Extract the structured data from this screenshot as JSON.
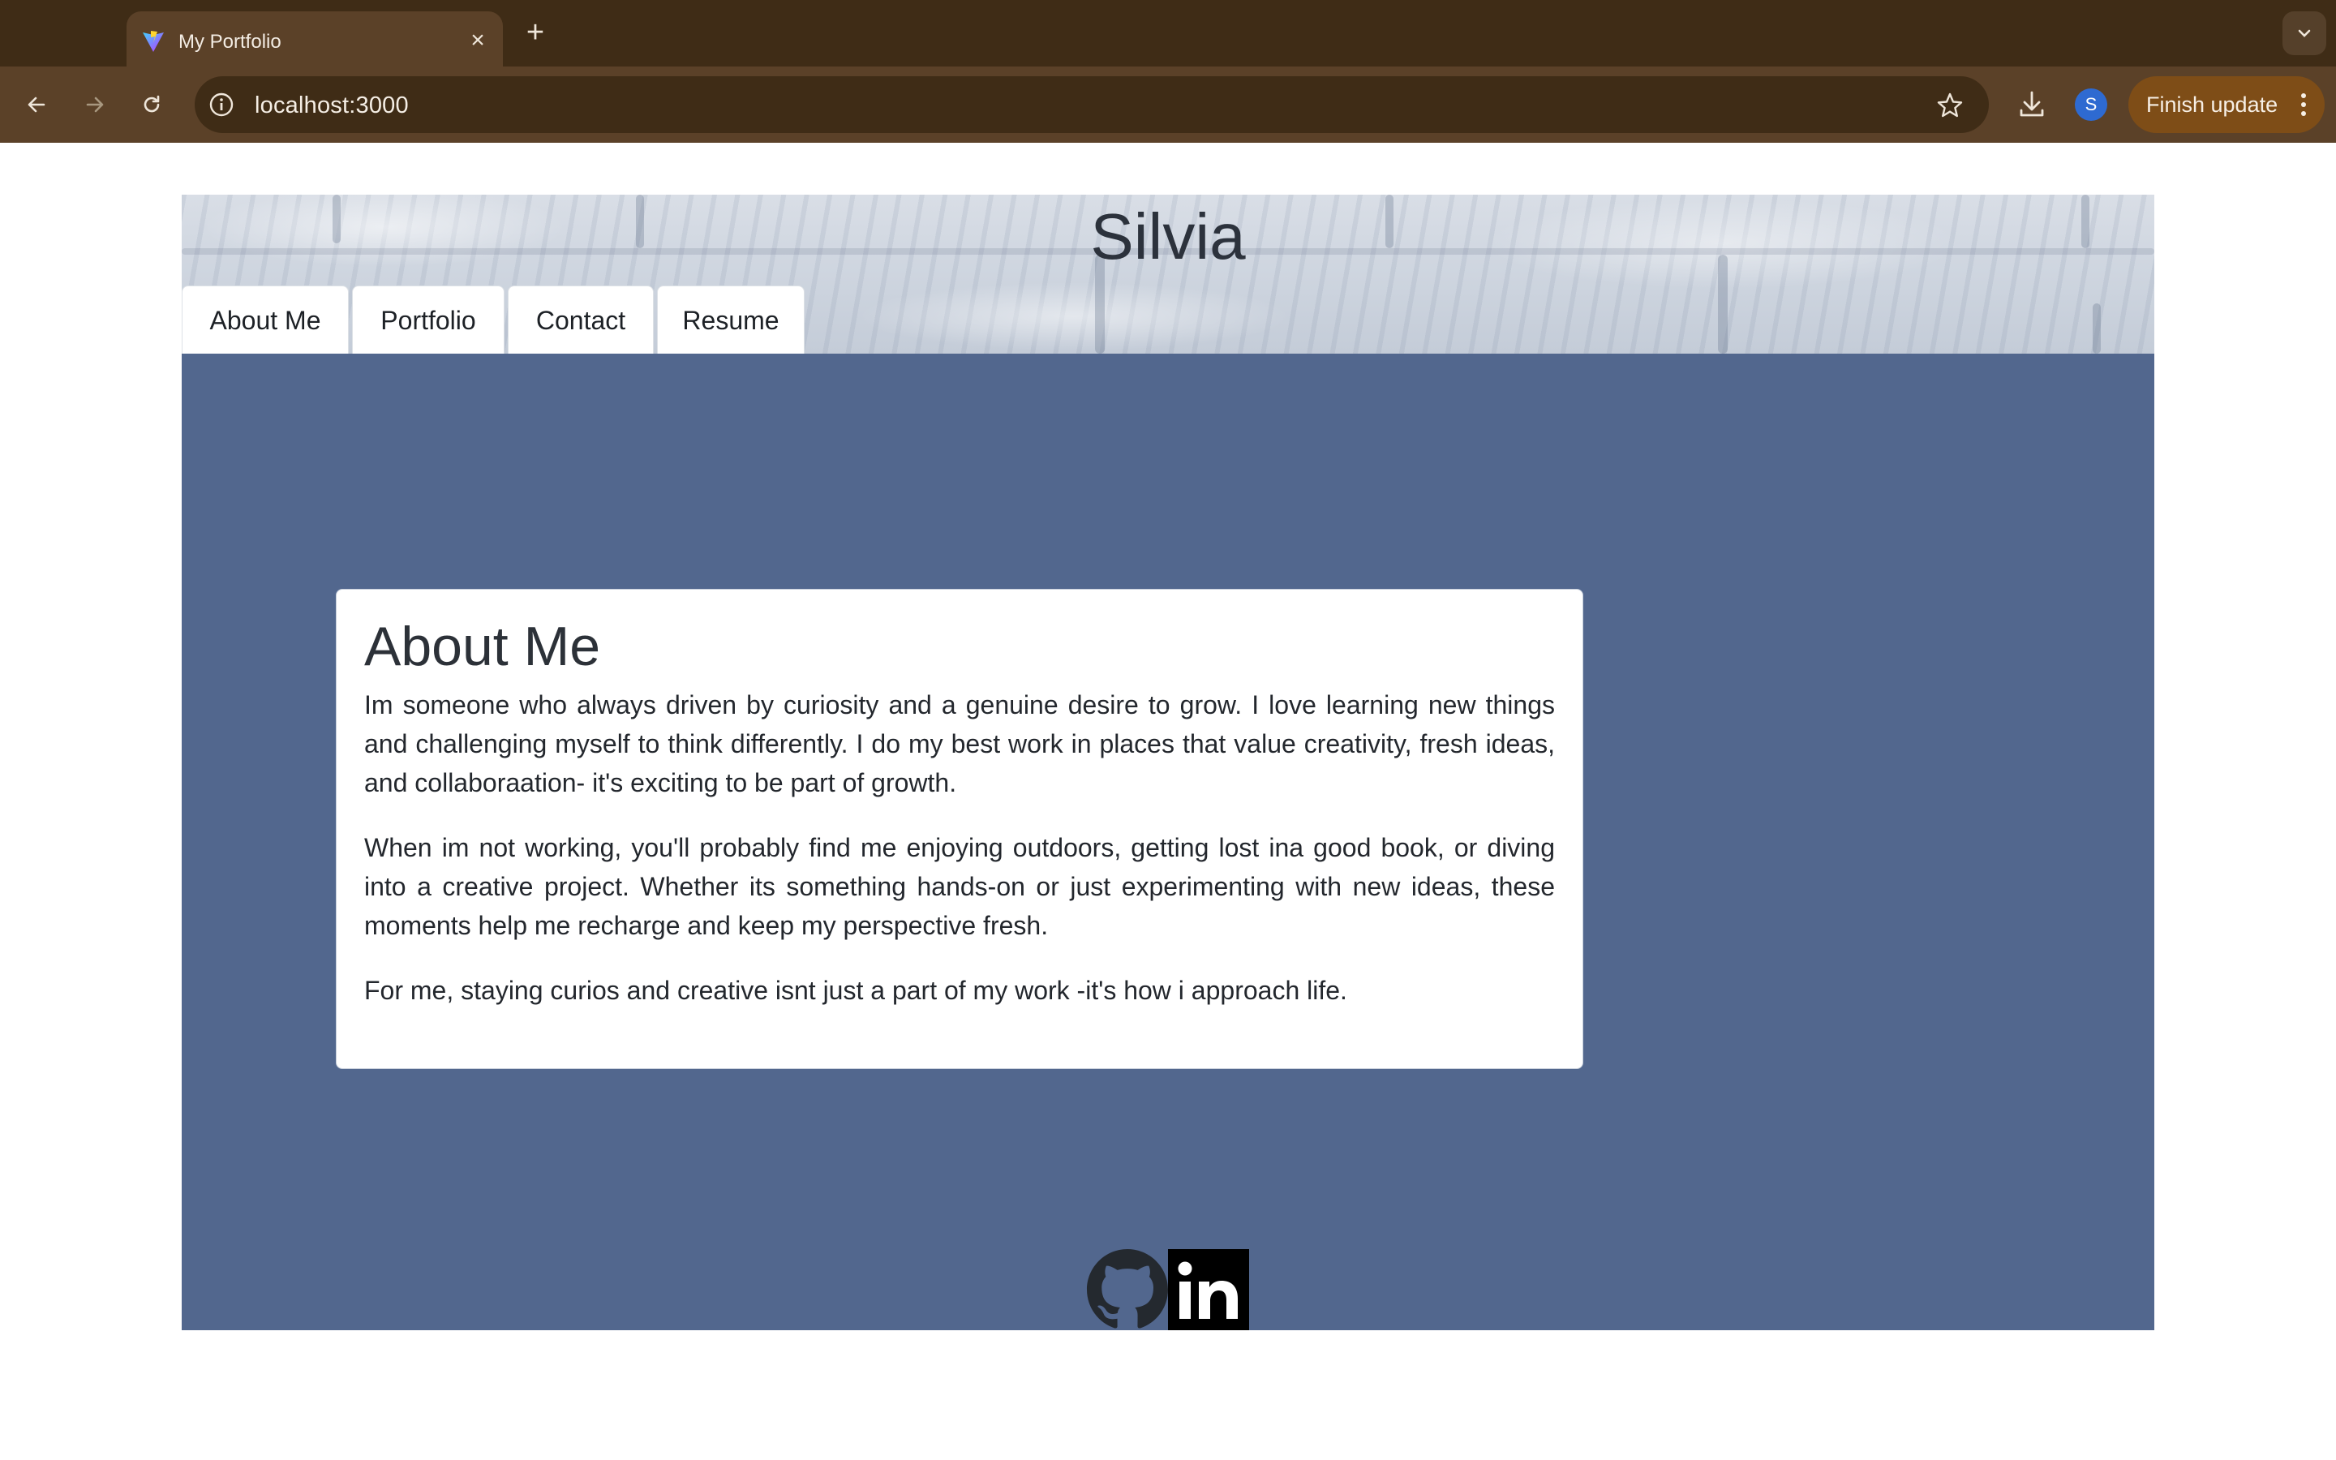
{
  "browser": {
    "tab_title": "My Portfolio",
    "url": "localhost:3000",
    "profile_initial": "S",
    "finish_update_label": "Finish update",
    "tab_close": "×",
    "new_tab": "+"
  },
  "site": {
    "title": "Silvia",
    "nav": [
      {
        "label": "About Me"
      },
      {
        "label": "Portfolio"
      },
      {
        "label": "Contact"
      },
      {
        "label": "Resume"
      }
    ],
    "about": {
      "heading": "About Me",
      "paragraphs": [
        "Im someone who always driven by curiosity and a genuine desire to grow. I love learning new things and challenging myself to think differently. I do my best work in places that value creativity, fresh ideas, and collaboraation- it's exciting to be part of growth.",
        "When im not working, you'll probably find me enjoying outdoors, getting lost ina good book, or diving into a creative project. Whether its something hands-on or just experimenting with new ideas, these moments help me recharge and keep my perspective fresh.",
        "For me, staying curios and creative isnt just a part of my work -it's how i approach life."
      ]
    },
    "footer_icons": [
      "github-icon",
      "linkedin-icon"
    ]
  },
  "colors": {
    "tabbar": "#3f2c16",
    "toolbar": "#5b4128",
    "main_background": "#52678e",
    "card": "#ffffff"
  }
}
